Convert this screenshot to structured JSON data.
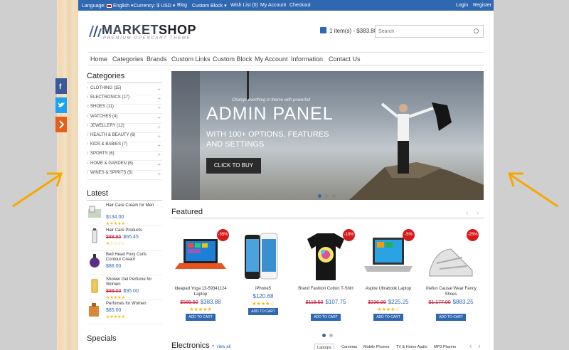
{
  "colors": {
    "accent": "#2f68b0",
    "sale": "#c8102e",
    "badge": "#d61a1a",
    "star": "#f5b800",
    "facebook": "#3b5998",
    "twitter": "#1da1f2",
    "share": "#e2601b",
    "arrow": "#f5a800"
  },
  "topbar": {
    "language": "Language:",
    "language_value": "English",
    "currency": "Currency: $ USD",
    "blog": "Blog",
    "custom_block": "Custom Block",
    "wishlist": "Wish List (0)",
    "account": "My Account",
    "checkout": "Checkout",
    "login": "Login",
    "register": "Register"
  },
  "header": {
    "logo_main": "MARKET",
    "logo_bold": "SHOP",
    "logo_sub": "PREMIUM OPENCART THEME",
    "cart": "1 item(s) - $383.88",
    "search_placeholder": "Search"
  },
  "nav": [
    "Home",
    "Categories",
    "Brands",
    "Custom Links",
    "Custom Block",
    "My Account",
    "Information",
    "Contact Us"
  ],
  "categories": {
    "title": "Categories",
    "items": [
      "CLOTHING (15)",
      "ELECTRONICS (17)",
      "SHOES (11)",
      "WATCHES (4)",
      "JEWELLERY (12)",
      "HEALTH & BEAUTY (6)",
      "KIDS & BABIES (7)",
      "SPORTS (6)",
      "HOME & GARDEN (6)",
      "WINES & SPIRITS (5)"
    ]
  },
  "latest": {
    "title": "Latest",
    "items": [
      {
        "name": "Hair Care Cream for Men",
        "old": "",
        "price": "$134.00",
        "stars": "★★★★★"
      },
      {
        "name": "Hair Care Products",
        "old": "$88.95",
        "price": "$65.45",
        "stars": "★☆☆☆☆"
      },
      {
        "name": "Bed Head Foxy Curls Contour Cream",
        "old": "",
        "price": "$88.00",
        "stars": ""
      },
      {
        "name": "Shower Gel Perfume for Women",
        "old": "$99.00",
        "price": "$95.00",
        "stars": "★★★★★"
      },
      {
        "name": "Perfumes for Women",
        "old": "",
        "price": "$85.00",
        "stars": "★★★★★"
      }
    ]
  },
  "specials_title": "Specials",
  "banner": {
    "tagline": "Change everthing in theme with powerfull",
    "headline": "ADMIN PANEL",
    "subline": "WITH 100+ OPTIONS, FEATURES AND SETTINGS",
    "cta": "CLICK TO BUY"
  },
  "featured": {
    "title": "Featured",
    "products": [
      {
        "name": "Ideapad Yoga 13-59341124 Laptop",
        "old": "$589.50",
        "price": "$383.88",
        "badge": "-35%",
        "stars": "★★★★★",
        "button": "ADD TO CART"
      },
      {
        "name": "iPhone5",
        "old": "",
        "price": "$120.68",
        "badge": "",
        "stars": "★★★★☆",
        "button": "ADD TO CART"
      },
      {
        "name": "Brand Fashion Cotton T-Shirt",
        "old": "$119.50",
        "price": "$107.75",
        "badge": "-10%",
        "stars": "",
        "button": "ADD TO CART"
      },
      {
        "name": "Aspire Ultrabook Laptop",
        "old": "$236.99",
        "price": "$225.25",
        "badge": "-5%",
        "stars": "★★★★☆",
        "button": "ADD TO CART"
      },
      {
        "name": "Xtefun Causal Wear Fancy Shoes",
        "old": "$1,177.00",
        "price": "$883.25",
        "badge": "-25%",
        "stars": "",
        "button": "ADD TO CART"
      }
    ]
  },
  "electronics": {
    "title": "Electronics",
    "sep": " - ",
    "view_all": "view all",
    "tabs": [
      "Laptops",
      "Cameras",
      "Mobile Phones",
      "TV & Home Audio",
      "MP3 Players"
    ]
  }
}
